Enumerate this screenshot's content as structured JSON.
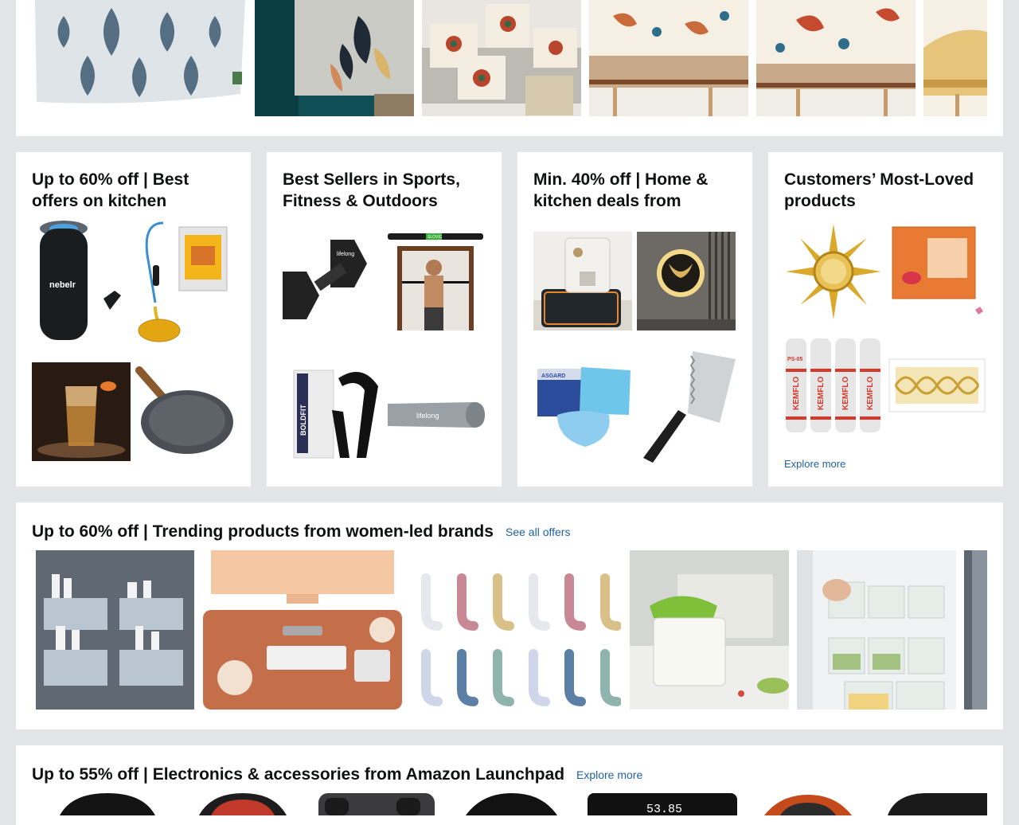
{
  "cards": [
    {
      "title": "Up to 60% off | Best offers on kitchen"
    },
    {
      "title": "Best Sellers in Sports, Fitness & Outdoors"
    },
    {
      "title": "Min. 40% off | Home & kitchen deals from"
    },
    {
      "title": "Customers’ Most-Loved products",
      "link": "Explore more"
    }
  ],
  "rows": [
    {
      "title": "Up to 60% off | Trending products from women-led brands",
      "link": "See all offers"
    },
    {
      "title": "Up to 55% off | Electronics & accessories from Amazon Launchpad",
      "link": "Explore more"
    }
  ],
  "product_text": {
    "purifier_brand": "nebelr",
    "fitness_brand": "BOLDFIT",
    "bar_brand": "SLOVIC",
    "mat_brand": "lifelong",
    "dumbbell_brand": "lifelong",
    "mask_brand": "ASGARD",
    "roll_brand": "KEMFLO",
    "roll_code": "PS-05",
    "scale_reading": "53.85"
  },
  "colors": {
    "page_bg": "#e3e6e6",
    "link": "#2162a1",
    "title": "#0f1111"
  }
}
